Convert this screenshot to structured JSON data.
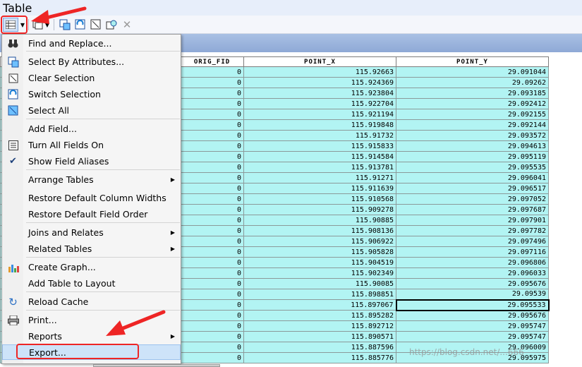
{
  "window": {
    "title": "Table"
  },
  "toolbar": {
    "buttons": [
      {
        "name": "table-options-icon"
      },
      {
        "name": "related-tables-icon"
      },
      {
        "name": "select-by-attributes-icon"
      },
      {
        "name": "switch-selection-icon"
      },
      {
        "name": "clear-selection-icon"
      },
      {
        "name": "zoom-to-selected-icon"
      },
      {
        "name": "delete-selected-icon"
      }
    ]
  },
  "menu": {
    "items": [
      {
        "label": "Find and Replace...",
        "icon": "binoculars-icon"
      },
      {
        "label": "Select By Attributes...",
        "icon": "select-by-attributes-icon"
      },
      {
        "label": "Clear Selection",
        "icon": "clear-selection-icon"
      },
      {
        "label": "Switch Selection",
        "icon": "switch-selection-icon"
      },
      {
        "label": "Select All",
        "icon": "select-all-icon"
      },
      {
        "label": "Add Field...",
        "icon": ""
      },
      {
        "label": "Turn All Fields On",
        "icon": "fields-list-icon"
      },
      {
        "label": "Show Field Aliases",
        "icon": "checkmark-icon"
      },
      {
        "label": "Arrange Tables",
        "icon": "",
        "submenu": true
      },
      {
        "label": "Restore Default Column Widths",
        "icon": ""
      },
      {
        "label": "Restore Default Field Order",
        "icon": ""
      },
      {
        "label": "Joins and Relates",
        "icon": "",
        "submenu": true
      },
      {
        "label": "Related Tables",
        "icon": "",
        "submenu": true
      },
      {
        "label": "Create Graph...",
        "icon": "bar-chart-icon"
      },
      {
        "label": "Add Table to Layout",
        "icon": ""
      },
      {
        "label": "Reload Cache",
        "icon": "refresh-icon"
      },
      {
        "label": "Print...",
        "icon": "printer-icon"
      },
      {
        "label": "Reports",
        "icon": "",
        "submenu": true
      },
      {
        "label": "Export...",
        "icon": ""
      }
    ]
  },
  "table": {
    "columns": [
      "ORIG_FID",
      "POINT_X",
      "POINT_Y"
    ],
    "rows": [
      [
        "0",
        "115.92663",
        "29.091044"
      ],
      [
        "0",
        "115.924369",
        "29.09262"
      ],
      [
        "0",
        "115.923804",
        "29.093185"
      ],
      [
        "0",
        "115.922704",
        "29.092412"
      ],
      [
        "0",
        "115.921194",
        "29.092155"
      ],
      [
        "0",
        "115.919848",
        "29.092144"
      ],
      [
        "0",
        "115.91732",
        "29.093572"
      ],
      [
        "0",
        "115.915833",
        "29.094613"
      ],
      [
        "0",
        "115.914584",
        "29.095119"
      ],
      [
        "0",
        "115.913781",
        "29.095535"
      ],
      [
        "0",
        "115.91271",
        "29.096041"
      ],
      [
        "0",
        "115.911639",
        "29.096517"
      ],
      [
        "0",
        "115.910568",
        "29.097052"
      ],
      [
        "0",
        "115.909278",
        "29.097687"
      ],
      [
        "0",
        "115.90885",
        "29.097901"
      ],
      [
        "0",
        "115.908136",
        "29.097782"
      ],
      [
        "0",
        "115.906922",
        "29.097496"
      ],
      [
        "0",
        "115.905828",
        "29.097116"
      ],
      [
        "0",
        "115.904519",
        "29.096806"
      ],
      [
        "0",
        "115.902349",
        "29.096033"
      ],
      [
        "0",
        "115.90085",
        "29.095676"
      ],
      [
        "0",
        "115.898851",
        "29.09539"
      ],
      [
        "0",
        "115.897067",
        "29.095533"
      ],
      [
        "0",
        "115.895282",
        "29.095676"
      ],
      [
        "0",
        "115.892712",
        "29.095747"
      ],
      [
        "0",
        "115.890571",
        "29.095747"
      ],
      [
        "0",
        "115.887596",
        "29.096009"
      ],
      [
        "0",
        "115.885776",
        "29.095975"
      ]
    ]
  },
  "watermark": "https://blog.csdn.net/...666",
  "colors": {
    "cell_bg": "#b2f4f3",
    "highlight": "#cde3f9",
    "annotation": "#ee2525"
  }
}
